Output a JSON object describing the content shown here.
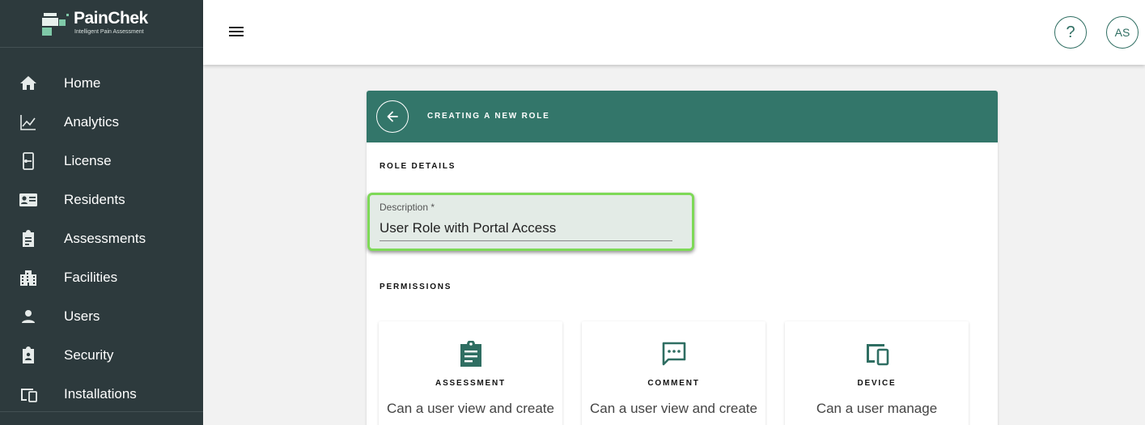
{
  "brand": {
    "name": "PainChek",
    "tagline": "Intelligent Pain Assessment",
    "accent_color": "#33766a",
    "sidebar_color": "#2d3a3d"
  },
  "sidebar": {
    "items": [
      {
        "label": "Home",
        "icon": "home-icon"
      },
      {
        "label": "Analytics",
        "icon": "analytics-icon"
      },
      {
        "label": "License",
        "icon": "license-icon"
      },
      {
        "label": "Residents",
        "icon": "residents-icon"
      },
      {
        "label": "Assessments",
        "icon": "assessments-icon"
      },
      {
        "label": "Facilities",
        "icon": "facilities-icon"
      },
      {
        "label": "Users",
        "icon": "users-icon"
      },
      {
        "label": "Security",
        "icon": "security-icon"
      },
      {
        "label": "Installations",
        "icon": "installations-icon"
      }
    ]
  },
  "topbar": {
    "help_label": "?",
    "avatar_initials": "AS"
  },
  "card": {
    "header_title": "CREATING A NEW ROLE",
    "role_details_label": "ROLE DETAILS",
    "description_field": {
      "label": "Description *",
      "value": "User Role with Portal Access"
    },
    "permissions_label": "PERMISSIONS",
    "permissions": [
      {
        "title": "ASSESSMENT",
        "description": "Can a user view and create",
        "icon": "clipboard-icon"
      },
      {
        "title": "COMMENT",
        "description": "Can a user view and create",
        "icon": "comment-icon"
      },
      {
        "title": "DEVICE",
        "description": "Can a user manage",
        "icon": "devices-icon"
      }
    ]
  }
}
